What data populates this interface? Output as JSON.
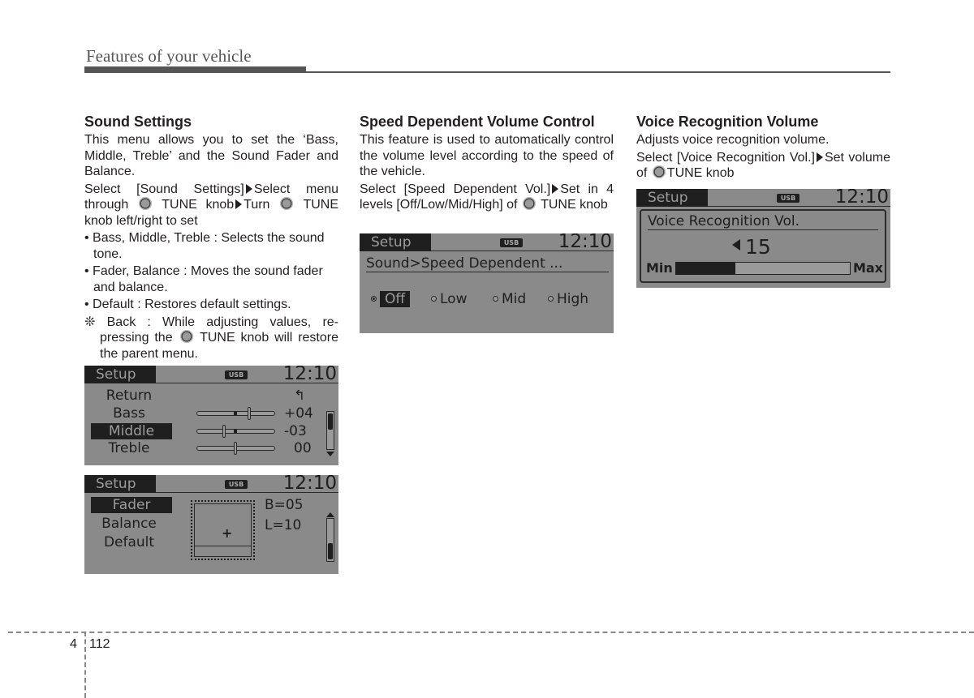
{
  "header": {
    "title": "Features of your vehicle"
  },
  "sections": {
    "sound_settings": {
      "title": "Sound Settings",
      "intro": "This menu allows you to set the ‘Bass, Middle, Treble’ and the Sound Fader and Balance.",
      "step_a": "Select [Sound Settings]",
      "step_b": "Select menu through",
      "step_c": "TUNE knob",
      "step_d": "Turn",
      "step_e": "TUNE knob left/right to set",
      "bullets": [
        "• Bass, Middle, Treble : Selects the sound tone.",
        "• Fader, Balance : Moves the sound fader and balance.",
        "• Default : Restores default settings."
      ],
      "note_a": "❊ Back : While adjusting values, re-pressing the",
      "note_b": "TUNE knob will restore the parent menu."
    },
    "speed_dependent": {
      "title": "Speed Dependent Volume Control",
      "intro": "This feature is used to automatically control the volume level according to the speed of the vehicle.",
      "step_a": "Select [Speed Dependent Vol.]",
      "step_b": "Set in 4 levels [Off/Low/Mid/High] of",
      "step_c": "TUNE knob"
    },
    "voice_recognition": {
      "title": "Voice Recognition Volume",
      "intro": "Adjusts voice recognition volume.",
      "step_a": "Select [Voice Recognition Vol.]",
      "step_b": "Set volume of",
      "step_c": "TUNE knob"
    }
  },
  "screens": {
    "common": {
      "mode": "Setup",
      "source": "USB",
      "time": "12:10"
    },
    "tone": {
      "return_label": "Return",
      "return_icon": "↰",
      "rows": [
        {
          "label": "Bass",
          "value": "+04",
          "level": 4
        },
        {
          "label": "Middle",
          "value": "-03",
          "level": -3,
          "selected": true
        },
        {
          "label": "Treble",
          "value": "00",
          "level": 0
        }
      ],
      "scroll_position": "top"
    },
    "fader": {
      "items": [
        "Fader",
        "Balance",
        "Default"
      ],
      "selected": "Fader",
      "fade_value": "B=05",
      "balance_value": "L=10",
      "cross_icon": "+",
      "scroll_position": "bottom"
    },
    "speed": {
      "breadcrumb": "Sound>Speed Dependent ...",
      "options": [
        "Off",
        "Low",
        "Mid",
        "High"
      ],
      "selected": "Off"
    },
    "voice": {
      "title": "Voice Recognition Vol.",
      "volume": "15",
      "min_label": "Min",
      "max_label": "Max",
      "fill_fraction": 0.34
    }
  },
  "footer": {
    "chapter": "4",
    "page": "112"
  }
}
